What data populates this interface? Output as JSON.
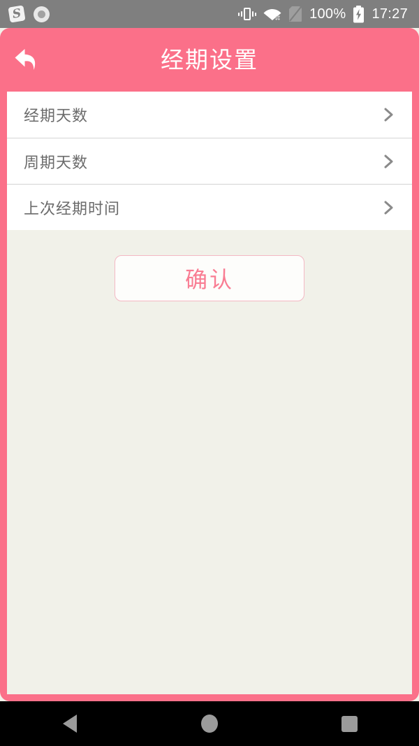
{
  "status_bar": {
    "left_icons": [
      "sogou-ime-icon",
      "circle-record-icon"
    ],
    "right_icons": [
      "vibrate-icon",
      "wifi-disconnected-icon",
      "sim-card-off-icon",
      "battery-charging-icon"
    ],
    "battery_text": "100%",
    "time_text": "17:27",
    "background_color": "#7f7f7f"
  },
  "header": {
    "title": "经期设置",
    "back_icon": "back-arrow-icon",
    "background_color": "#fb7089",
    "title_color": "#ffffff"
  },
  "list": {
    "rows": [
      {
        "label": "经期天数",
        "chevron": "chevron-right-icon"
      },
      {
        "label": "周期天数",
        "chevron": "chevron-right-icon"
      },
      {
        "label": "上次经期时间",
        "chevron": "chevron-right-icon"
      }
    ]
  },
  "confirm_button": {
    "label": "确认",
    "text_color": "#f97d93",
    "border_color": "#f4b8c4",
    "background_color": "#fdfdfb"
  },
  "content": {
    "background_color": "#f1f1e9"
  },
  "nav_bar": {
    "background_color": "#000000",
    "buttons": [
      "back-triangle-icon",
      "home-circle-icon",
      "recents-square-icon"
    ]
  }
}
